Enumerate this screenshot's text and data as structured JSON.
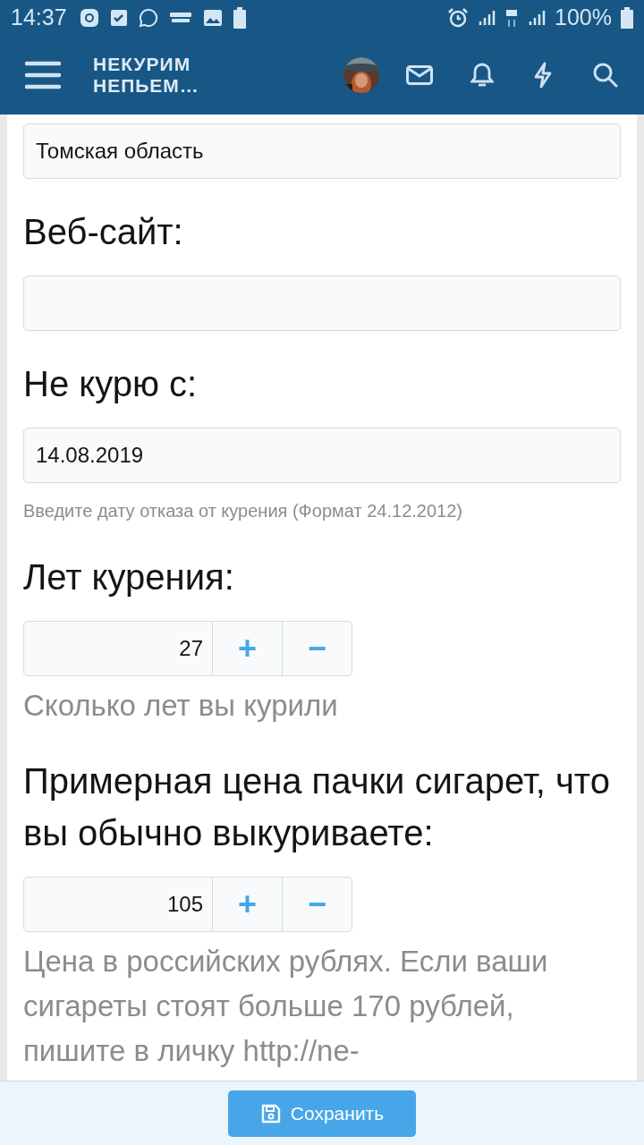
{
  "status_bar": {
    "time": "14:37",
    "battery": "100%"
  },
  "header": {
    "title": "НЕКУРИМ НЕПЬЕМ…"
  },
  "fields": [
    {
      "kind": "text",
      "value": "Томская область"
    },
    {
      "kind": "text",
      "label": "Веб-сайт:"
    },
    {
      "kind": "text",
      "label": "Не курю с:",
      "value": "14.08.2019",
      "hint": "Введите дату отказа от курения (Формат 24.12.2012)"
    },
    {
      "kind": "number",
      "label": "Лет курения:",
      "value": "27",
      "hint": "Сколько лет вы курили",
      "plus": "+",
      "minus": "−"
    },
    {
      "kind": "number",
      "label": "Примерная цена пачки сигарет, что вы обычно выкуриваете:",
      "value": "105",
      "hint": "Цена в российских рублях. Если ваши сигареты стоят больше 170 рублей, пишите в личку http://ne-",
      "plus": "+",
      "minus": "−"
    }
  ],
  "save_button": {
    "label": "Сохранить"
  }
}
